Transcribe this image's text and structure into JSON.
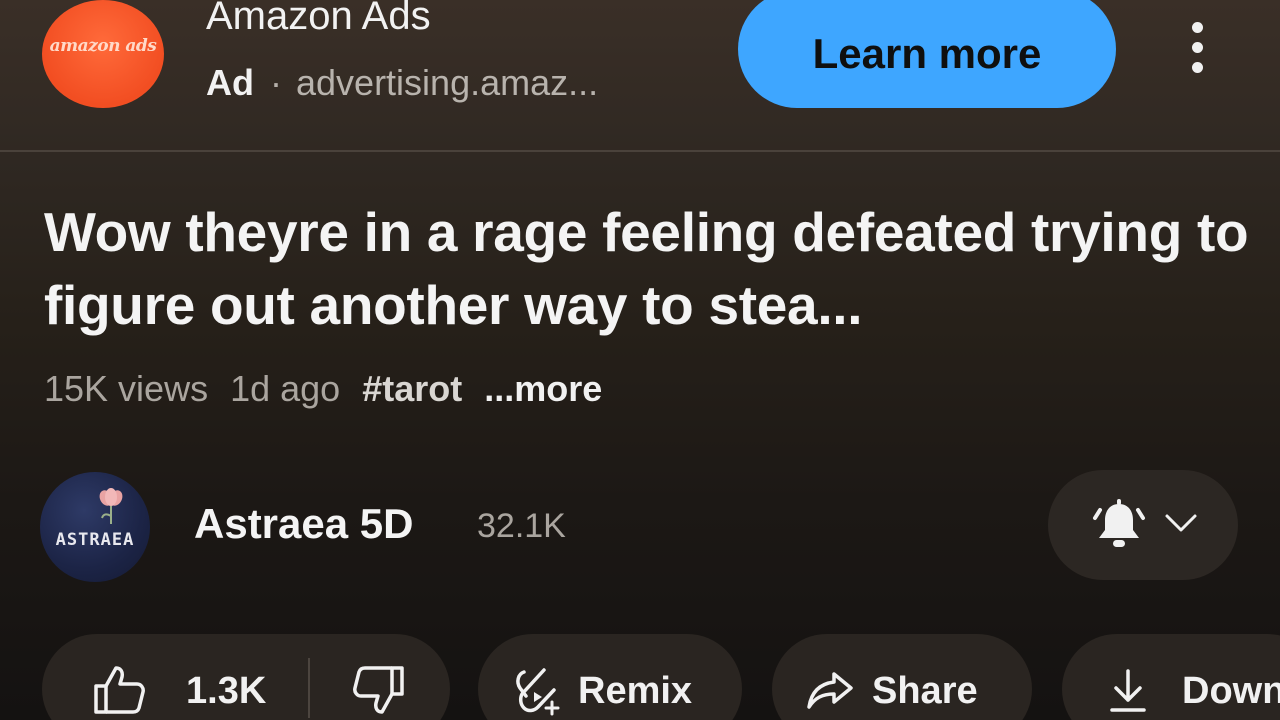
{
  "ad": {
    "logo_text": "amazon ads",
    "advertiser": "Amazon Ads",
    "label": "Ad",
    "separator": "·",
    "url": "advertising.amaz...",
    "cta": "Learn more"
  },
  "video": {
    "title": "Wow theyre in a rage feeling defeated trying to figure out another way to stea...",
    "views": "15K views",
    "age": "1d ago",
    "hashtag": "#tarot",
    "more": "...more"
  },
  "channel": {
    "avatar_text": "ASTRAEA",
    "name": "Astraea 5D",
    "subscribers": "32.1K"
  },
  "actions": {
    "likes": "1.3K",
    "remix": "Remix",
    "share": "Share",
    "download": "Down"
  },
  "colors": {
    "accent": "#3ea6ff",
    "ad_logo": "#f24e22",
    "pill_bg": "#2a2521"
  },
  "icons": [
    "kebab-menu-icon",
    "bell-icon",
    "chevron-down-icon",
    "thumbs-up-icon",
    "thumbs-down-icon",
    "remix-icon",
    "share-icon",
    "download-icon"
  ]
}
